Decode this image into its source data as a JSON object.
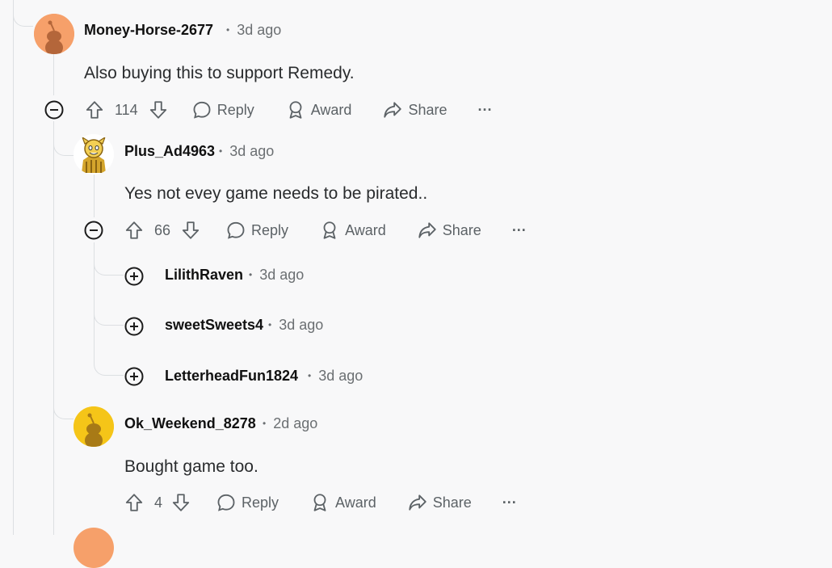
{
  "comments": [
    {
      "username": "Money-Horse-2677",
      "time": "3d ago",
      "body": "Also buying this to support Remedy.",
      "votes": "114",
      "avatar_color": "#f6a06a"
    },
    {
      "username": "Plus_Ad4963",
      "time": "3d ago",
      "body": "Yes not evey game needs to be pirated..",
      "votes": "66"
    },
    {
      "username": "Ok_Weekend_8278",
      "time": "2d ago",
      "body": "Bought game too.",
      "votes": "4",
      "avatar_color": "#f5c518"
    }
  ],
  "collapsed_replies": [
    {
      "username": "LilithRaven",
      "time": "3d ago"
    },
    {
      "username": "sweetSweets4",
      "time": "3d ago"
    },
    {
      "username": "LetterheadFun1824",
      "time": "3d ago"
    }
  ],
  "actions": {
    "reply": "Reply",
    "award": "Award",
    "share": "Share",
    "more": "···",
    "separator": "•"
  },
  "icons": [
    "collapse-icon",
    "expand-icon",
    "upvote-icon",
    "downvote-icon",
    "reply-icon",
    "award-icon",
    "share-icon",
    "more-icon"
  ]
}
